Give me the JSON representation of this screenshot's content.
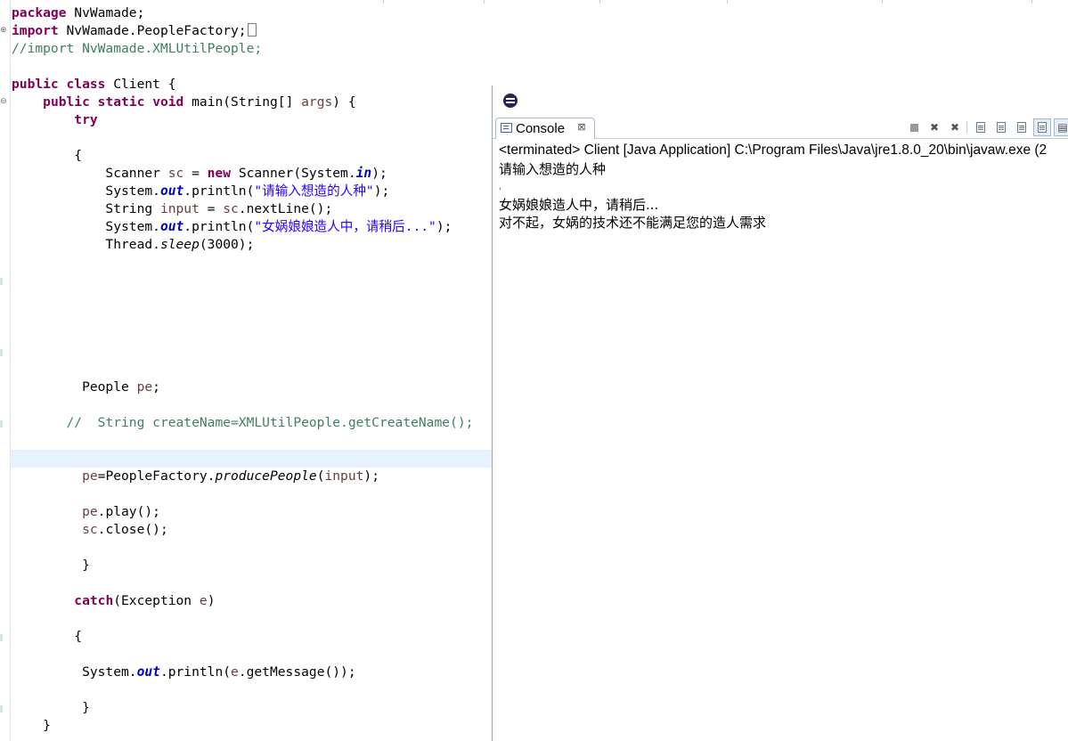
{
  "editor": {
    "lines": [
      {
        "segments": [
          {
            "t": "package",
            "c": "kw"
          },
          {
            "t": " NvWamade;"
          }
        ]
      },
      {
        "segments": [
          {
            "t": "import",
            "c": "kw"
          },
          {
            "t": " NvWamade.PeopleFactory;"
          },
          {
            "t": "",
            "c": "cursorbox"
          }
        ]
      },
      {
        "segments": [
          {
            "t": "//import NvWamade.XMLUtilPeople;",
            "c": "cm"
          }
        ]
      },
      {
        "segments": []
      },
      {
        "segments": [
          {
            "t": "public",
            "c": "kw"
          },
          {
            "t": " "
          },
          {
            "t": "class",
            "c": "kw"
          },
          {
            "t": " Client {"
          }
        ]
      },
      {
        "segments": [
          {
            "t": "    "
          },
          {
            "t": "public",
            "c": "kw"
          },
          {
            "t": " "
          },
          {
            "t": "static",
            "c": "kw"
          },
          {
            "t": " "
          },
          {
            "t": "void",
            "c": "kw"
          },
          {
            "t": " main(String[] "
          },
          {
            "t": "args",
            "c": "vr"
          },
          {
            "t": ") {"
          }
        ]
      },
      {
        "segments": [
          {
            "t": "        "
          },
          {
            "t": "try",
            "c": "kw"
          }
        ]
      },
      {
        "segments": []
      },
      {
        "segments": [
          {
            "t": "        {"
          }
        ]
      },
      {
        "segments": [
          {
            "t": "            Scanner "
          },
          {
            "t": "sc",
            "c": "vr"
          },
          {
            "t": " = "
          },
          {
            "t": "new",
            "c": "kw"
          },
          {
            "t": " Scanner(System."
          },
          {
            "t": "in",
            "c": "fld"
          },
          {
            "t": ");"
          }
        ]
      },
      {
        "segments": [
          {
            "t": "            System."
          },
          {
            "t": "out",
            "c": "fld"
          },
          {
            "t": ".println("
          },
          {
            "t": "\"请输入想造的人种\"",
            "c": "st"
          },
          {
            "t": ");"
          }
        ]
      },
      {
        "segments": [
          {
            "t": "            String "
          },
          {
            "t": "input",
            "c": "vr"
          },
          {
            "t": " = "
          },
          {
            "t": "sc",
            "c": "vr"
          },
          {
            "t": ".nextLine();"
          }
        ]
      },
      {
        "segments": [
          {
            "t": "            System."
          },
          {
            "t": "out",
            "c": "fld"
          },
          {
            "t": ".println("
          },
          {
            "t": "\"女娲娘娘造人中，请稍后...\"",
            "c": "st"
          },
          {
            "t": ");"
          }
        ]
      },
      {
        "segments": [
          {
            "t": "            Thread."
          },
          {
            "t": "sleep",
            "c": "it"
          },
          {
            "t": "(3000);"
          }
        ]
      },
      {
        "segments": []
      },
      {
        "segments": []
      },
      {
        "segments": []
      },
      {
        "segments": []
      },
      {
        "segments": []
      },
      {
        "segments": []
      },
      {
        "segments": []
      },
      {
        "segments": [
          {
            "t": "         People "
          },
          {
            "t": "pe",
            "c": "vr"
          },
          {
            "t": ";"
          }
        ]
      },
      {
        "segments": []
      },
      {
        "segments": [
          {
            "t": "       "
          },
          {
            "t": "//  String createName=XMLUtilPeople.getCreateName();",
            "c": "cm"
          }
        ]
      },
      {
        "segments": []
      },
      {
        "segments": []
      },
      {
        "segments": [
          {
            "t": "         "
          },
          {
            "t": "pe",
            "c": "vr"
          },
          {
            "t": "=PeopleFactory."
          },
          {
            "t": "producePeople",
            "c": "it"
          },
          {
            "t": "("
          },
          {
            "t": "input",
            "c": "vr"
          },
          {
            "t": ");"
          }
        ]
      },
      {
        "segments": []
      },
      {
        "segments": [
          {
            "t": "         "
          },
          {
            "t": "pe",
            "c": "vr"
          },
          {
            "t": ".play();"
          }
        ]
      },
      {
        "segments": [
          {
            "t": "         "
          },
          {
            "t": "sc",
            "c": "vr"
          },
          {
            "t": ".close();"
          }
        ]
      },
      {
        "segments": []
      },
      {
        "segments": [
          {
            "t": "         }"
          }
        ]
      },
      {
        "segments": []
      },
      {
        "segments": [
          {
            "t": "        "
          },
          {
            "t": "catch",
            "c": "kw"
          },
          {
            "t": "(Exception "
          },
          {
            "t": "e",
            "c": "vr"
          },
          {
            "t": ")"
          }
        ]
      },
      {
        "segments": []
      },
      {
        "segments": [
          {
            "t": "        {"
          }
        ]
      },
      {
        "segments": []
      },
      {
        "segments": [
          {
            "t": "         System."
          },
          {
            "t": "out",
            "c": "fld"
          },
          {
            "t": ".println("
          },
          {
            "t": "e",
            "c": "vr"
          },
          {
            "t": ".getMessage());"
          }
        ]
      },
      {
        "segments": []
      },
      {
        "segments": [
          {
            "t": "         }"
          }
        ]
      },
      {
        "segments": [
          {
            "t": "    }"
          }
        ]
      }
    ]
  },
  "console": {
    "tab_label": "Console",
    "tab_close": "⊠",
    "status": "<terminated> Client [Java Application] C:\\Program Files\\Java\\jre1.8.0_20\\bin\\javaw.exe (2",
    "output": [
      "请输入想造的人种",
      ",",
      "女娲娘娘造人中，请稍后...",
      "对不起，女娲的技术还不能满足您的造人需求"
    ],
    "toolbar": [
      {
        "name": "terminate-icon",
        "glyph": "",
        "type": "square"
      },
      {
        "name": "remove-launch-icon",
        "glyph": "✖",
        "type": "glyph"
      },
      {
        "name": "remove-all-terminated-icon",
        "glyph": "✖",
        "type": "glyph"
      },
      {
        "name": "scroll-lock-icon",
        "glyph": "",
        "type": "doc"
      },
      {
        "name": "word-wrap-icon",
        "glyph": "",
        "type": "doc"
      },
      {
        "name": "show-when-stdout-icon",
        "glyph": "",
        "type": "doc"
      },
      {
        "name": "show-when-stderr-icon",
        "glyph": "",
        "type": "doc"
      },
      {
        "name": "pin-console-icon",
        "glyph": "▤",
        "type": "glyph"
      }
    ]
  }
}
